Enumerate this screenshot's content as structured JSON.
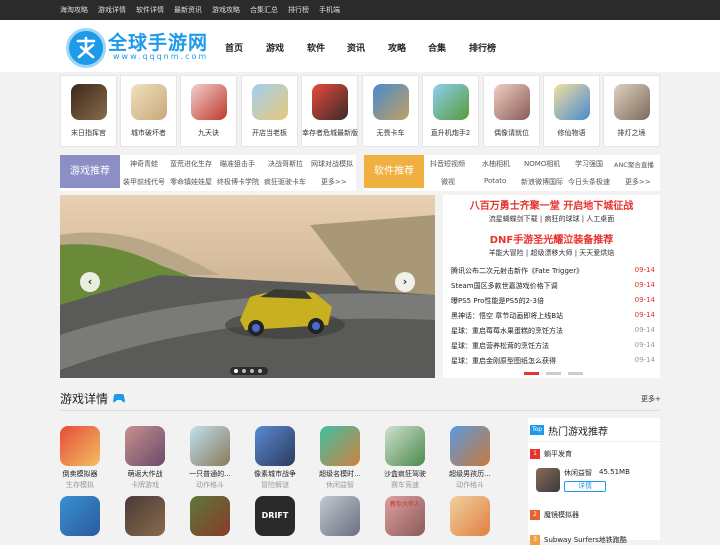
{
  "topbar": {
    "links": [
      "海淘攻略",
      "游戏详情",
      "软件详情",
      "最新资讯",
      "游戏攻略",
      "合集汇总",
      "排行榜",
      "手机端"
    ]
  },
  "logo": {
    "name": "全球手游网",
    "url": "www.qqqnm.com"
  },
  "nav": {
    "items": [
      "首页",
      "游戏",
      "软件",
      "资讯",
      "攻略",
      "合集",
      "排行榜"
    ]
  },
  "featured_games": [
    {
      "name": "末日指挥官",
      "color": "#5a4a3a"
    },
    {
      "name": "城市破坏者",
      "color": "#d9c9a8"
    },
    {
      "name": "九天诀",
      "color": "#c0392b"
    },
    {
      "name": "开店当老板",
      "color": "#e8c878"
    },
    {
      "name": "幸存者危城最新版",
      "color": "#c0392b"
    },
    {
      "name": "无畏卡车",
      "color": "#3a6fb0"
    },
    {
      "name": "直升机炮手2",
      "color": "#4aa3df"
    },
    {
      "name": "偶像请就位",
      "color": "#f0c0c0"
    },
    {
      "name": "修仙物语",
      "color": "#e8d8a0"
    },
    {
      "name": "排灯之境",
      "color": "#c8b8a8"
    }
  ],
  "game_rec": {
    "title": "游戏推荐",
    "row1": [
      "神奇青蛙",
      "蛮荒进化生存",
      "瞄准狙击手",
      "决战哥斯拉",
      "网球对战模拟"
    ],
    "row2": [
      "装甲前线代号",
      "零命镇娃娃屋",
      "终极博卡学院",
      "疯狂驱驶卡车",
      "更多>>"
    ]
  },
  "soft_rec": {
    "title": "软件推荐",
    "row1": [
      "抖音短视频",
      "水柚相机",
      "NOMO相机",
      "学习强国",
      "ANC聚合直播"
    ],
    "row2": [
      "微视",
      "Potato",
      "新浪微博国际",
      "今日头条极速",
      "更多>>"
    ]
  },
  "banner": {
    "prev": "‹",
    "next": "›"
  },
  "news": {
    "headline1": "八百万勇士齐聚一堂 开启地下城征战",
    "sub1": "流星蝴蝶剑下载 | 疯狂的球球 | 人工桌面",
    "headline2": "DNF手游圣光耀泣装备推荐",
    "sub2": "羊能大冒险 | 超级漂移大师 | 天天爱烘焙",
    "items": [
      {
        "title": "腾讯公布二次元射击新作《Fate Trigger》",
        "date": "09-14",
        "hot": true
      },
      {
        "title": "Steam国区多款世嘉游戏价格下调",
        "date": "09-14",
        "hot": true
      },
      {
        "title": "曝PS5 Pro性能是PS5的2-3倍",
        "date": "09-14",
        "hot": true
      },
      {
        "title": "黑神话：悟空 章节动画即将上线B站",
        "date": "09-14",
        "hot": true
      },
      {
        "title": "星球：重启莓莓水果蛋糕的烹饪方法",
        "date": "09-14",
        "hot": false
      },
      {
        "title": "星球：重启营养松茸的烹饪方法",
        "date": "09-14",
        "hot": false
      },
      {
        "title": "星球：重启金刚原型图纸怎么获得",
        "date": "09-14",
        "hot": false
      }
    ]
  },
  "game_details": {
    "title": "游戏详情",
    "more": "更多+",
    "games": [
      {
        "name": "倒卖模拟器",
        "cat": "生存模拟",
        "color": "#c0392b"
      },
      {
        "name": "萌返大作战",
        "cat": "卡牌游戏",
        "color": "#8e6b8c"
      },
      {
        "name": "一只普通的...",
        "cat": "动作格斗",
        "color": "#8ab0d0"
      },
      {
        "name": "像素城市战争",
        "cat": "冒险解谜",
        "color": "#3a5fa0"
      },
      {
        "name": "超级名模时...",
        "cat": "休闲益智",
        "color": "#d09060"
      },
      {
        "name": "沙盒疯狂驾驶",
        "cat": "赛车竞速",
        "color": "#6a9a6a"
      },
      {
        "name": "超级男孩历...",
        "cat": "动作格斗",
        "color": "#5a8ad0"
      }
    ],
    "row2_colors": [
      "#3a90d0",
      "#4a3a3a",
      "#5a7a3a",
      "#2a2a2a",
      "#9aa0b0",
      "#c08080",
      "#e8a060"
    ],
    "row2_labels": [
      "DRIFT",
      "教你大作人"
    ]
  },
  "hot_games": {
    "badge": "Top",
    "title": "热门游戏推荐",
    "items": [
      {
        "rank": "1",
        "name": "躺平发育"
      },
      {
        "rank": "2",
        "name": "魔镜模拟器"
      },
      {
        "rank": "3",
        "name": "Subway Surfers地铁跑酷"
      }
    ],
    "detail": {
      "name": "休闲益智",
      "size": "45.51MB",
      "button": "详情"
    }
  },
  "colors": {
    "accent": "#1e9be8",
    "red": "#e8322c",
    "purple": "#8b8fc6",
    "orange": "#f0b040"
  }
}
